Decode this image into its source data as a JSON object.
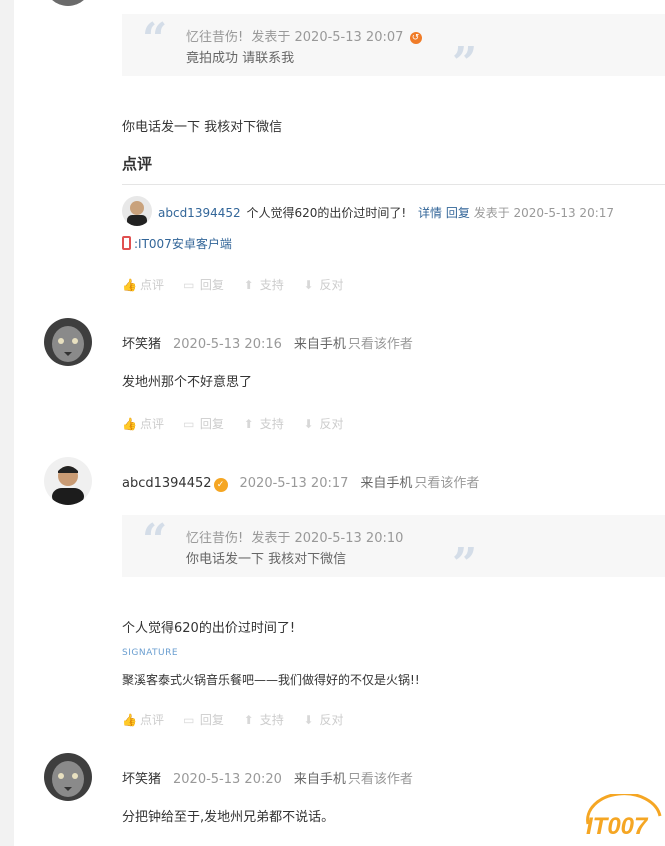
{
  "quote1": {
    "author": "忆往昔伤!",
    "posted_prefix": "发表于",
    "time": "2020-5-13 20:07",
    "back_icon": "return-arrow-icon",
    "body": "竟拍成功 请联系我"
  },
  "reply1_text": "你电话发一下 我核对下微信",
  "comment_section": {
    "title": "点评",
    "entry": {
      "user": "abcd1394452",
      "text": "个人觉得620的出价过时间了!",
      "detail_link": "详情",
      "reply_link": "回复",
      "posted": "发表于 2020-5-13 20:17"
    },
    "client_label": ":IT007安卓客户端"
  },
  "actions": {
    "rate": "点评",
    "reply": "回复",
    "support": "支持",
    "oppose": "反对"
  },
  "post2": {
    "user": "坏笑猪",
    "time": "2020-5-13 20:16",
    "from": "来自手机",
    "only_author": "只看该作者",
    "text": "发地州那个不好意思了"
  },
  "post3": {
    "user": "abcd1394452",
    "time": "2020-5-13 20:17",
    "from": "来自手机",
    "only_author": "只看该作者",
    "quote": {
      "author": "忆往昔伤!",
      "posted_prefix": "发表于",
      "time": "2020-5-13 20:10",
      "body": "你电话发一下 我核对下微信"
    },
    "text": "个人觉得620的出价过时间了!",
    "signature_label": "SIGNATURE",
    "signature": "聚溪客泰式火锅音乐餐吧——我们做得好的不仅是火锅!!"
  },
  "post4": {
    "user": "坏笑猪",
    "time": "2020-5-13 20:20",
    "from": "来自手机",
    "only_author": "只看该作者",
    "text": "分把钟给至于,发地州兄弟都不说话。"
  },
  "logo_text": "IT007",
  "colors": {
    "link": "#336699",
    "accent_orange": "#f5a623",
    "muted": "#999999"
  }
}
